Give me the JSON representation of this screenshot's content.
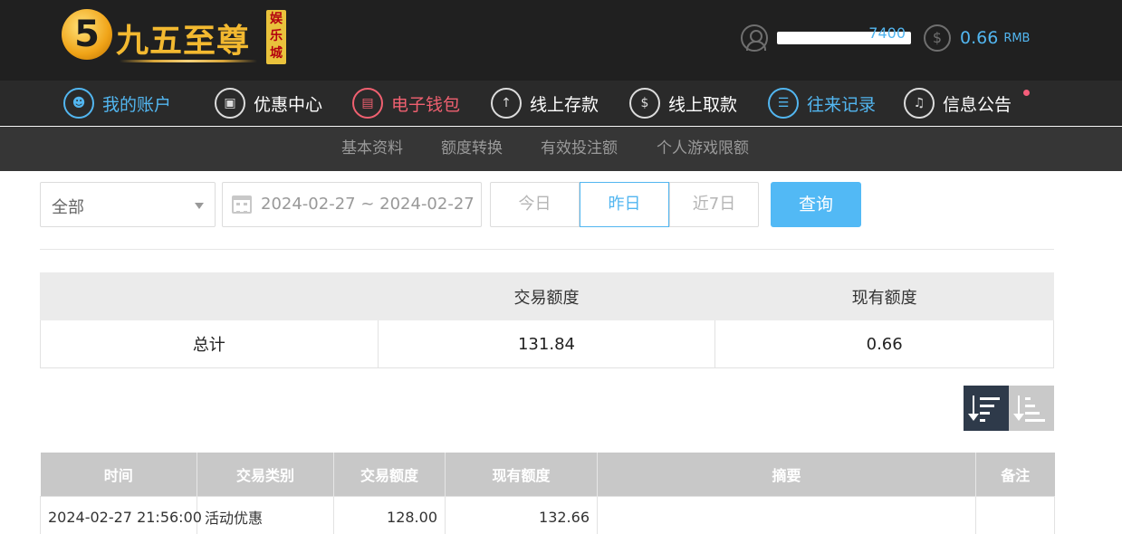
{
  "brand": {
    "badge": "5",
    "name": "九五至尊",
    "tag": "娱乐城"
  },
  "user": {
    "username_fragment": "7400"
  },
  "wallet": {
    "balance": "0.66",
    "unit": "RMB"
  },
  "main_nav": [
    {
      "label": "我的账户",
      "icon": "user-icon",
      "state": "active"
    },
    {
      "label": "优惠中心",
      "icon": "gift-icon",
      "state": "normal"
    },
    {
      "label": "电子钱包",
      "icon": "wallet-icon",
      "state": "highlight"
    },
    {
      "label": "线上存款",
      "icon": "deposit-icon",
      "state": "normal"
    },
    {
      "label": "线上取款",
      "icon": "withdraw-icon",
      "state": "normal"
    },
    {
      "label": "往来记录",
      "icon": "records-icon",
      "state": "active"
    },
    {
      "label": "信息公告",
      "icon": "bell-icon",
      "state": "normal"
    }
  ],
  "sub_nav": [
    "基本资料",
    "额度转换",
    "有效投注额",
    "个人游戏限额"
  ],
  "filters": {
    "type_selected": "全部",
    "date_range": "2024-02-27 ~ 2024-02-27",
    "quick_ranges": [
      "今日",
      "昨日",
      "近7日"
    ],
    "active_quick": "昨日",
    "search_label": "查询"
  },
  "summary": {
    "headers": [
      "",
      "交易额度",
      "现有额度"
    ],
    "row_label": "总计",
    "transaction_total": "131.84",
    "current_balance": "0.66"
  },
  "records": {
    "headers": [
      "时间",
      "交易类别",
      "交易额度",
      "现有额度",
      "摘要",
      "备注"
    ],
    "rows": [
      {
        "time": "2024-02-27 21:56:00",
        "type": "活动优惠",
        "amount": "128.00",
        "balance": "132.66",
        "summary": "",
        "note": ""
      }
    ]
  },
  "colors": {
    "accent_blue": "#52b6f0",
    "highlight_red": "#f06070",
    "header_bg": "#202020",
    "notify_dot": "#f45d7a"
  }
}
